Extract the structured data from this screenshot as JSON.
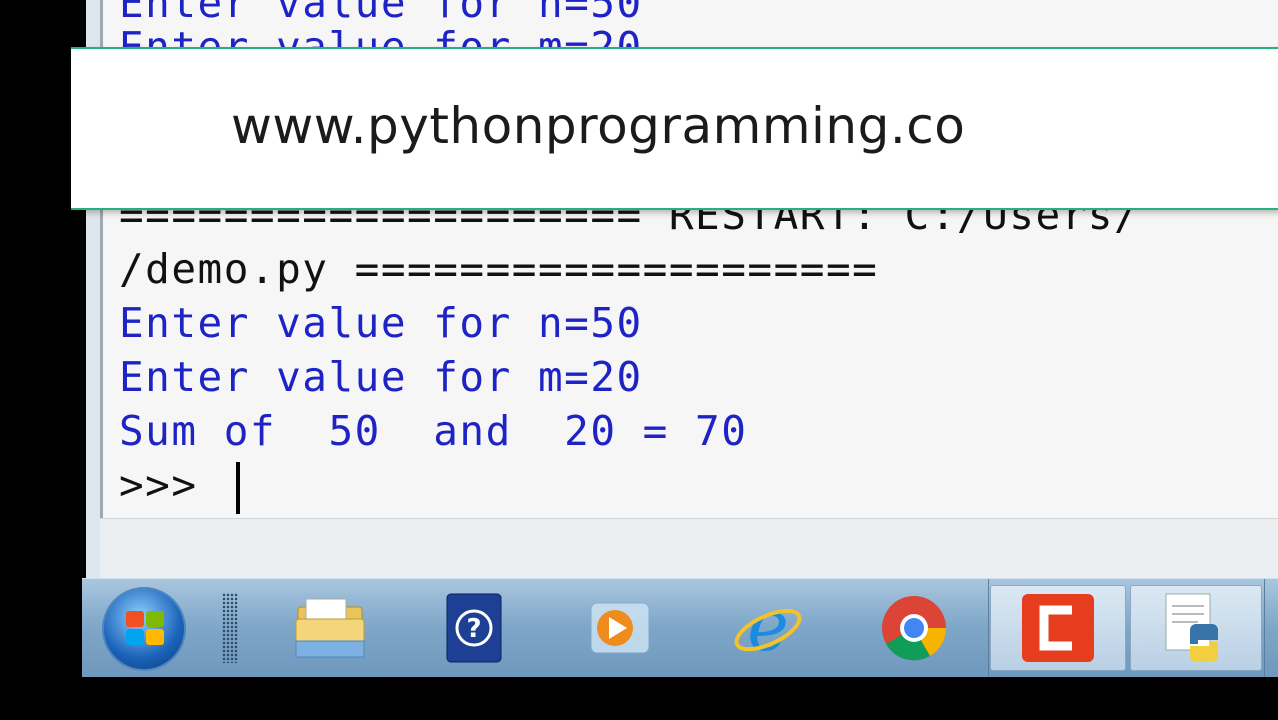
{
  "shell": {
    "lines": [
      "Enter value for n=50",
      "Enter value for m=20",
      "==================== RESTART: C:/Users/",
      "/demo.py ====================",
      "Enter value for n=50",
      "Enter value for m=20",
      "Sum of  50  and  20 = 70",
      ">>> "
    ]
  },
  "banner": {
    "text": "www.pythonprogramming.co"
  },
  "taskbar": {
    "items": [
      "windows-start-icon",
      "folder-icon",
      "help-icon",
      "media-player-icon",
      "internet-explorer-icon",
      "chrome-icon",
      "camtasia-icon",
      "python-file-icon"
    ]
  },
  "colors": {
    "output_blue": "#1e23c4",
    "banner_border": "#26b07d",
    "taskbar": "#7ea6c8"
  }
}
